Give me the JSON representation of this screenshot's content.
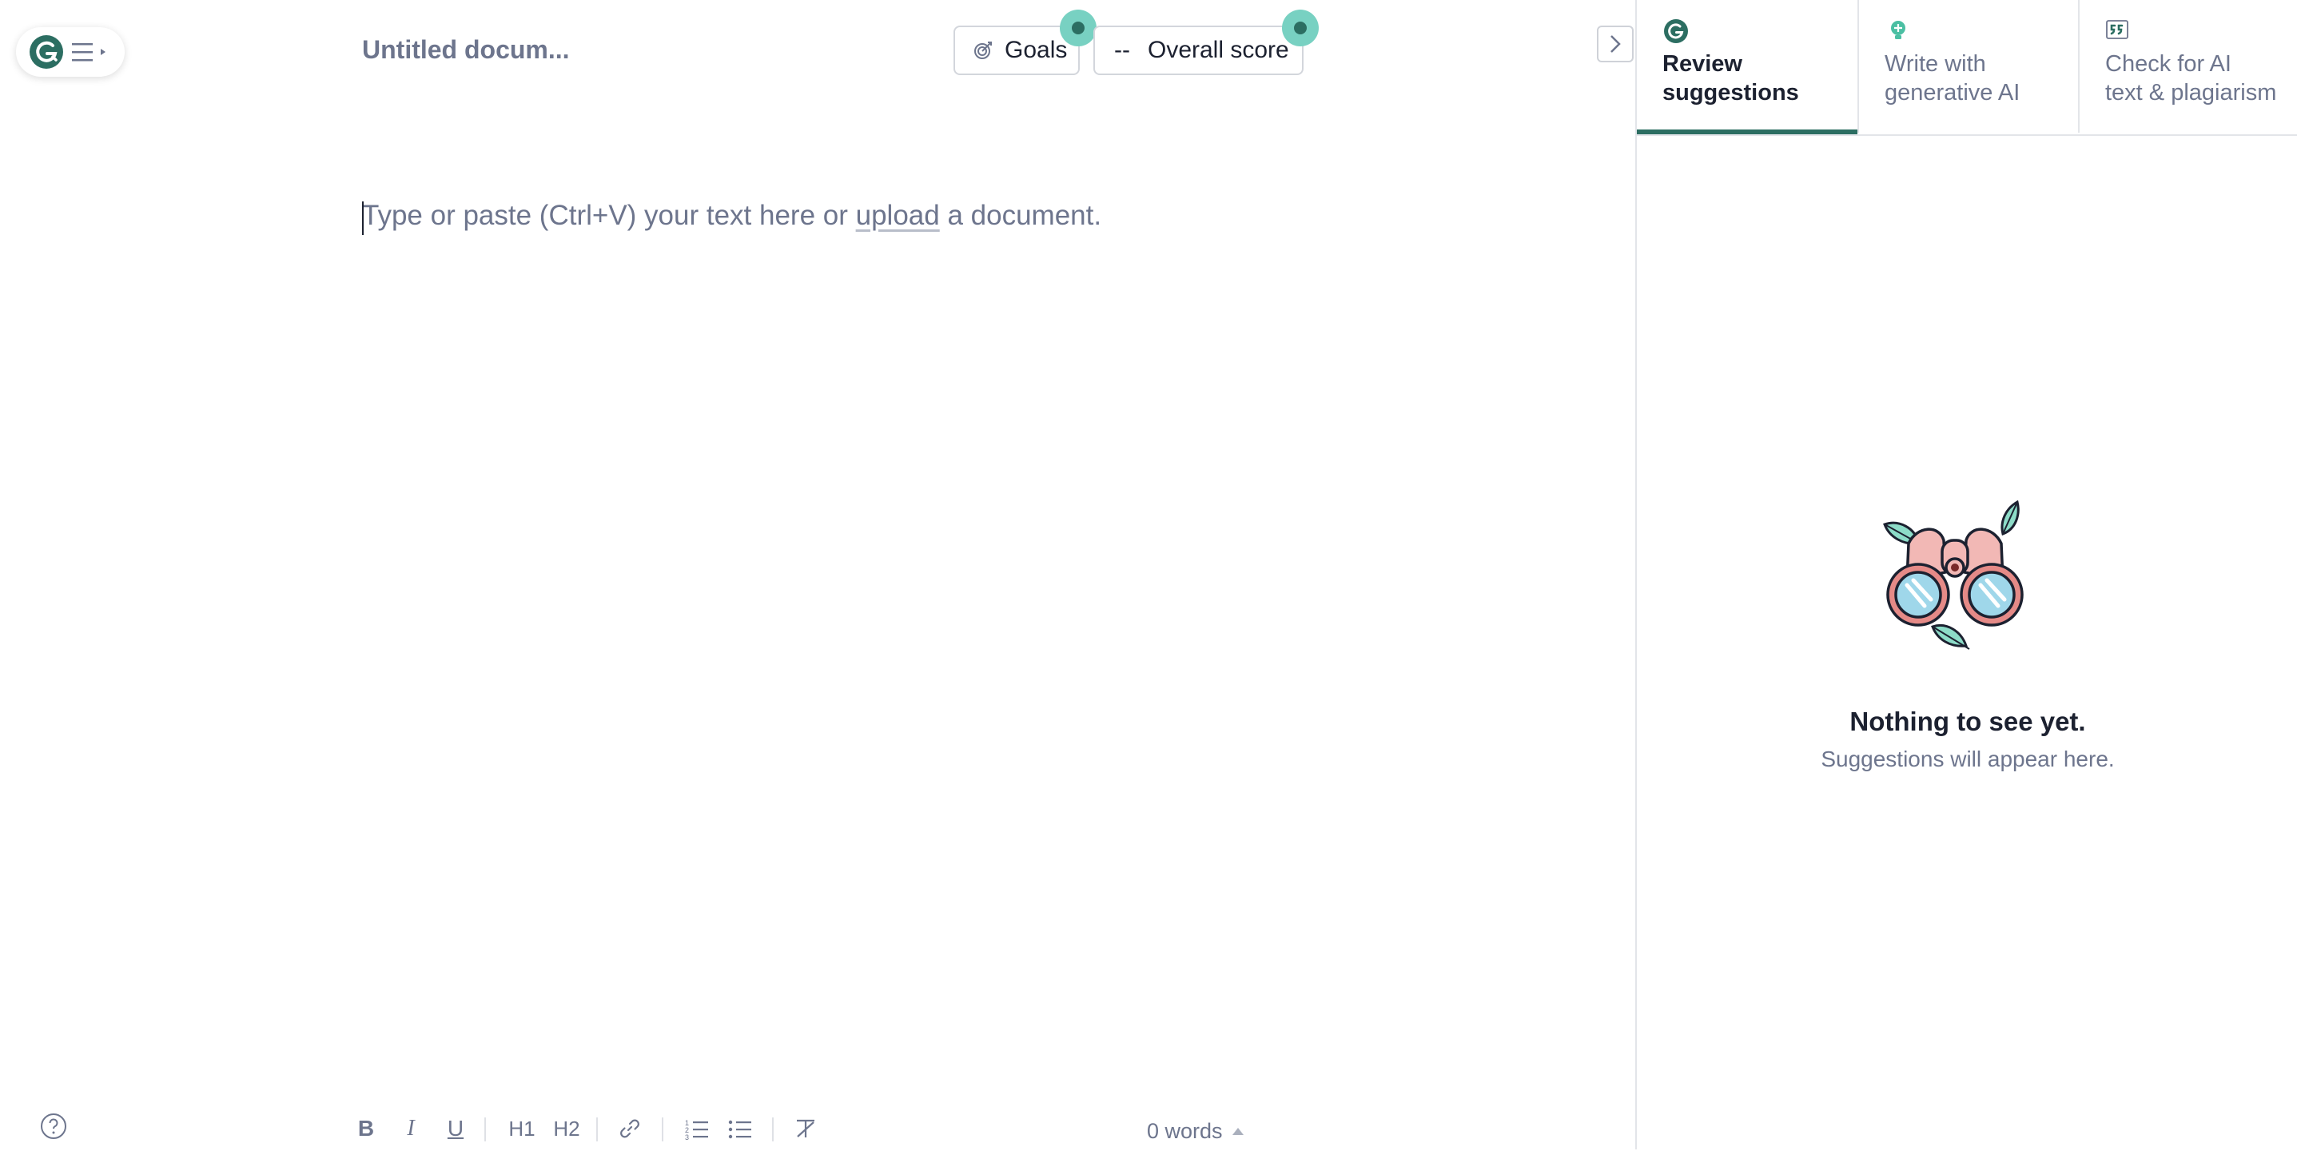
{
  "header": {
    "doc_title": "Untitled docum...",
    "goals_label": "Goals",
    "score_prefix": "--",
    "score_label": "Overall score"
  },
  "editor": {
    "placeholder_before": "Type or paste (Ctrl+V) your text here or ",
    "upload_link": "upload",
    "placeholder_after": " a document."
  },
  "toolbar": {
    "bold": "B",
    "italic": "I",
    "underline": "U",
    "h1": "H1",
    "h2": "H2",
    "word_count": "0 words"
  },
  "panel": {
    "tabs": [
      {
        "label_line1": "Review",
        "label_line2": "suggestions",
        "icon": "grammarly-g-icon",
        "active": true
      },
      {
        "label_line1": "Write with",
        "label_line2": "generative AI",
        "icon": "lightbulb-icon",
        "active": false
      },
      {
        "label_line1": "Check for AI",
        "label_line2": "text & plagiarism",
        "icon": "quote-icon",
        "active": false
      }
    ],
    "empty_title": "Nothing to see yet.",
    "empty_subtitle": "Suggestions will appear here."
  },
  "colors": {
    "brand_green": "#2c6e62",
    "badge_teal": "#78d1c2",
    "muted_text": "#6d758d"
  }
}
